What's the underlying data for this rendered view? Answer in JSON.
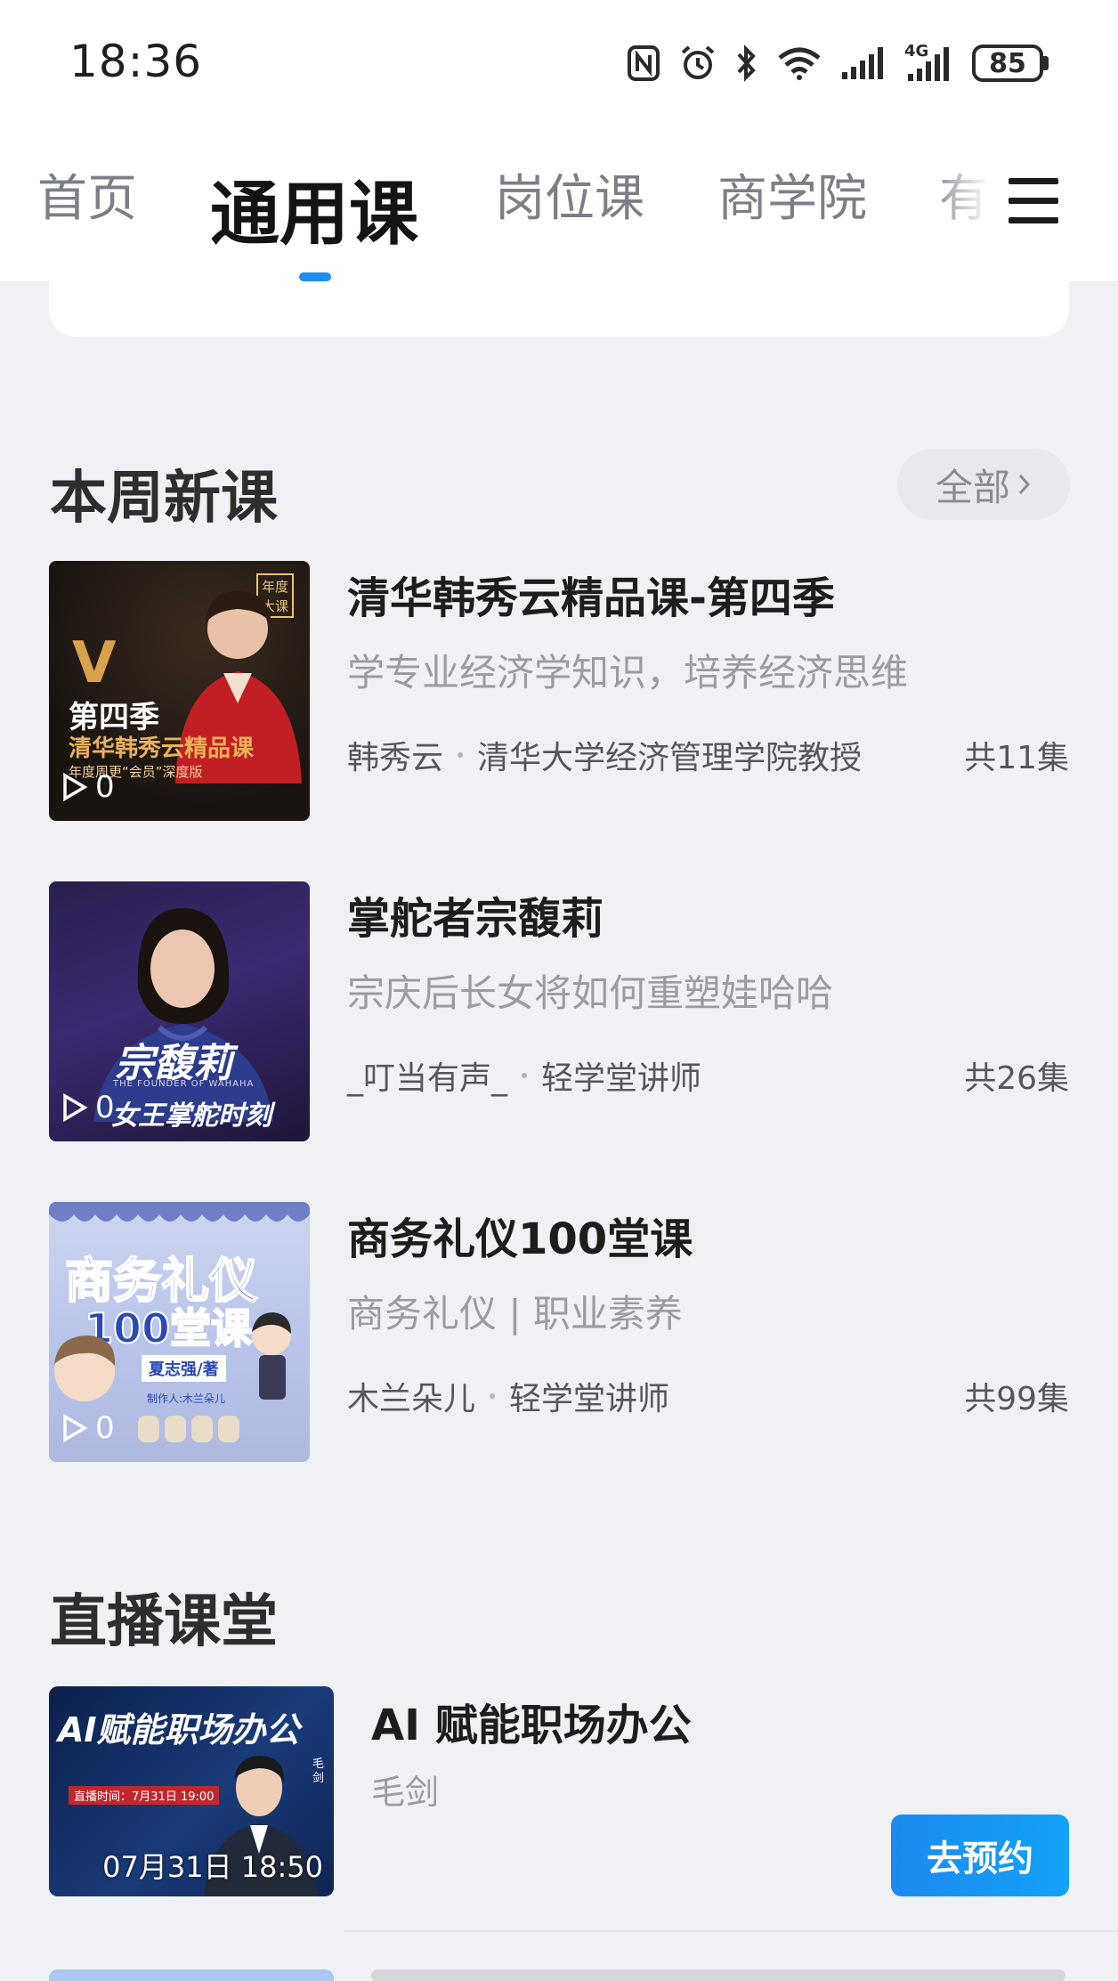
{
  "status_bar": {
    "time": "18:36",
    "network": "4G",
    "battery": "85",
    "icons": [
      "nfc-icon",
      "alarm-icon",
      "bluetooth-icon",
      "wifi-icon",
      "signal-icon",
      "signal-4g-icon",
      "battery-icon"
    ]
  },
  "nav": {
    "tabs": [
      {
        "label": "首页"
      },
      {
        "label": "通用课"
      },
      {
        "label": "岗位课"
      },
      {
        "label": "商学院"
      },
      {
        "label": "有"
      }
    ],
    "active_index": 1,
    "accent_color": "#1d8ff0"
  },
  "weekly": {
    "title": "本周新课",
    "all_label": "全部",
    "courses": [
      {
        "title": "清华韩秀云精品课-第四季",
        "subtitle": "学专业经济学知识，培养经济思维",
        "author": "韩秀云",
        "role": "清华大学经济管理学院教授",
        "episodes": "共11集",
        "plays": "0",
        "thumb": {
          "line1": "第四季",
          "line2": "清华韩秀云精品课",
          "line3": "年度周更“会员”深度版",
          "badge": "年度大课",
          "logo": "V"
        }
      },
      {
        "title": "掌舵者宗馥莉",
        "subtitle": "宗庆后长女将如何重塑娃哈哈",
        "author": "_叮当有声_",
        "role": "轻学堂讲师",
        "episodes": "共26集",
        "plays": "0",
        "thumb": {
          "line1": "宗馥莉",
          "line2": "THE FOUNDER OF WAHAHA",
          "line3": "女王掌舵时刻"
        }
      },
      {
        "title": "商务礼仪100堂课",
        "subtitle": "商务礼仪 | 职业素养",
        "author": "木兰朵儿",
        "role": "轻学堂讲师",
        "episodes": "共99集",
        "plays": "0",
        "thumb": {
          "line1": "商务礼仪",
          "line2": "100堂课",
          "line3": "夏志强/著",
          "line4": "制作人:木兰朵儿"
        }
      }
    ]
  },
  "live": {
    "title": "直播课堂",
    "items": [
      {
        "title": "AI 赋能职场办公",
        "host": "毛剑",
        "time": "07月31日 18:50",
        "button": "去预约",
        "thumb": {
          "headline": "AI赋能职场办公",
          "date_line": "直播时间：7月31日 19:00",
          "name_tag": "毛剑"
        }
      }
    ]
  }
}
